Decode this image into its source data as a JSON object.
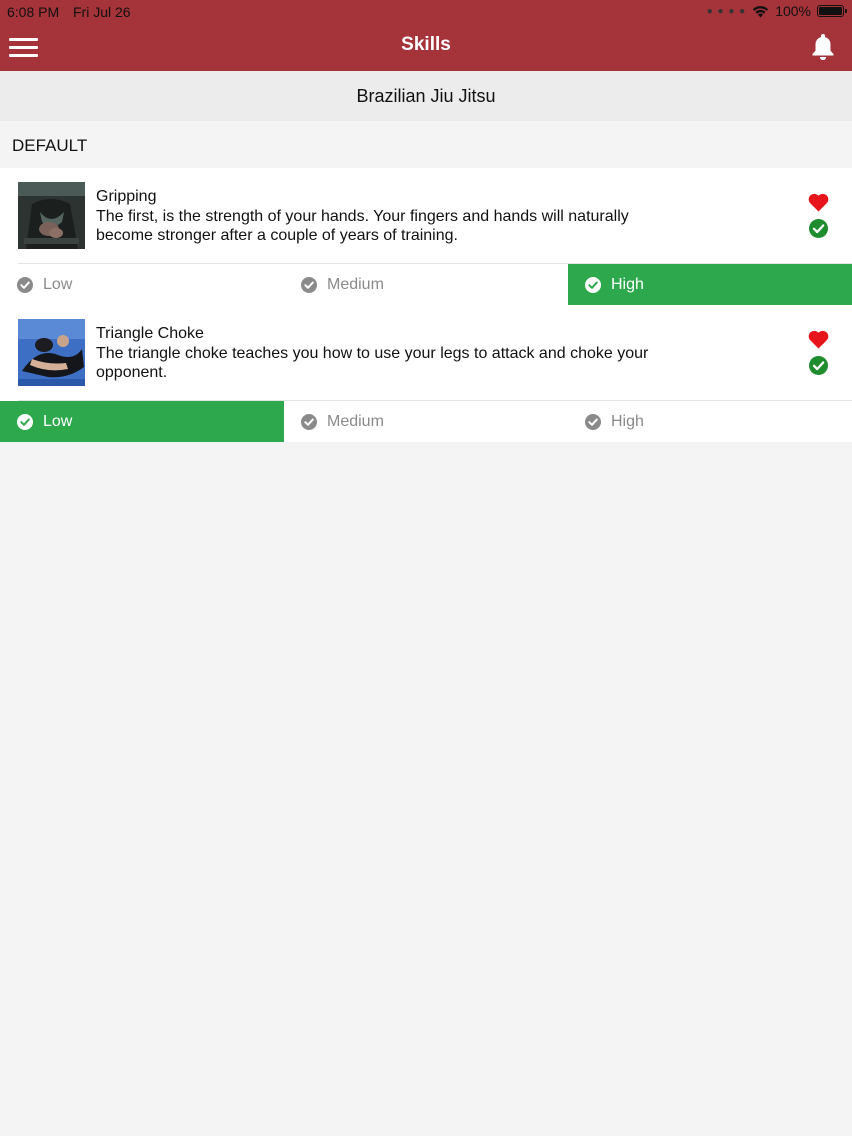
{
  "status": {
    "time": "6:08 PM",
    "date": "Fri Jul 26",
    "battery": "100%"
  },
  "nav": {
    "title": "Skills"
  },
  "subheader": {
    "title": "Brazilian Jiu Jitsu"
  },
  "section": {
    "label": "DEFAULT"
  },
  "skills": [
    {
      "title": "Gripping",
      "description": "The first, is the strength of your hands. Your fingers and hands will naturally become stronger after a couple of years of training.",
      "levels": [
        "Low",
        "Medium",
        "High"
      ],
      "selected_level": "High",
      "favorited": true,
      "completed": true
    },
    {
      "title": "Triangle Choke",
      "description": "The triangle choke teaches you how to use your legs to attack and choke your opponent.",
      "levels": [
        "Low",
        "Medium",
        "High"
      ],
      "selected_level": "Low",
      "favorited": true,
      "completed": true
    }
  ],
  "colors": {
    "header": "#a5333a",
    "active_level": "#2ea84c",
    "heart": "#e8141c",
    "check": "#1f8c2e"
  }
}
